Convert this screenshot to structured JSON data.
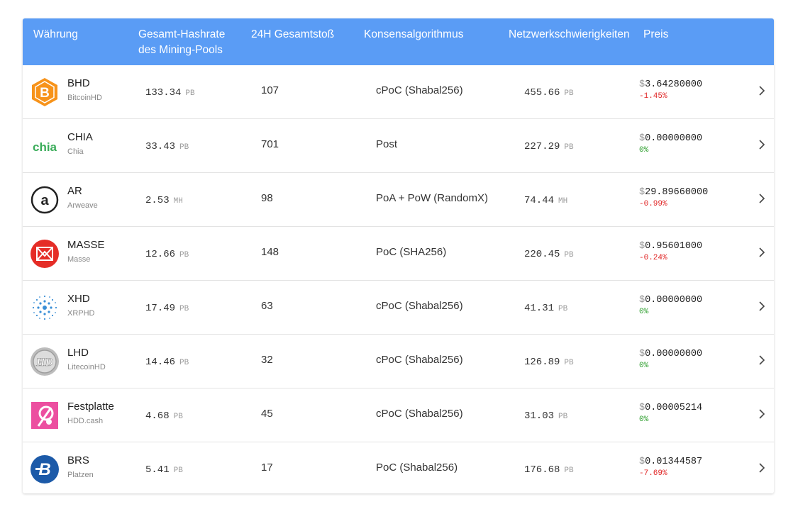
{
  "header": {
    "currency": "Währung",
    "hashrate_line1": "Gesamt-Hashrate",
    "hashrate_line2": "des Mining-Pools",
    "blocks": "24H Gesamtstoß",
    "algorithm": "Konsensalgorithmus",
    "difficulty": "Netzwerkschwierigkeiten",
    "price": "Preis"
  },
  "colors": {
    "header_bg": "#5a9cf5",
    "negative": "#e02424",
    "neutral": "#2a9d2a"
  },
  "rows": [
    {
      "symbol": "BHD",
      "name": "BitcoinHD",
      "icon": "bitcoinhd-logo",
      "hashrate": "133.34",
      "hashrate_unit": "PB",
      "blocks": "107",
      "algorithm": "cPoC (Shabal256)",
      "difficulty": "455.66",
      "difficulty_unit": "PB",
      "currency_symbol": "$",
      "price": "3.64280000",
      "change": "-1.45%"
    },
    {
      "symbol": "CHIA",
      "name": "Chia",
      "icon": "chia-logo",
      "hashrate": "33.43",
      "hashrate_unit": "PB",
      "blocks": "701",
      "algorithm": "Post",
      "difficulty": "227.29",
      "difficulty_unit": "PB",
      "currency_symbol": "$",
      "price": "0.00000000",
      "change": "0%"
    },
    {
      "symbol": "AR",
      "name": "Arweave",
      "icon": "arweave-logo",
      "hashrate": "2.53",
      "hashrate_unit": "MH",
      "blocks": "98",
      "algorithm": "PoA + PoW (RandomX)",
      "difficulty": "74.44",
      "difficulty_unit": "MH",
      "currency_symbol": "$",
      "price": "29.89660000",
      "change": "-0.99%"
    },
    {
      "symbol": "MASSE",
      "name": "Masse",
      "icon": "mass-logo",
      "hashrate": "12.66",
      "hashrate_unit": "PB",
      "blocks": "148",
      "algorithm": "PoC (SHA256)",
      "difficulty": "220.45",
      "difficulty_unit": "PB",
      "currency_symbol": "$",
      "price": "0.95601000",
      "change": "-0.24%"
    },
    {
      "symbol": "XHD",
      "name": "XRPHD",
      "icon": "xrphd-logo",
      "hashrate": "17.49",
      "hashrate_unit": "PB",
      "blocks": "63",
      "algorithm": "cPoC (Shabal256)",
      "difficulty": "41.31",
      "difficulty_unit": "PB",
      "currency_symbol": "$",
      "price": "0.00000000",
      "change": "0%"
    },
    {
      "symbol": "LHD",
      "name": "LitecoinHD",
      "icon": "litecoinhd-logo",
      "hashrate": "14.46",
      "hashrate_unit": "PB",
      "blocks": "32",
      "algorithm": "cPoC (Shabal256)",
      "difficulty": "126.89",
      "difficulty_unit": "PB",
      "currency_symbol": "$",
      "price": "0.00000000",
      "change": "0%"
    },
    {
      "symbol": "Festplatte",
      "name": "HDD.cash",
      "icon": "hddcash-logo",
      "hashrate": "4.68",
      "hashrate_unit": "PB",
      "blocks": "45",
      "algorithm": "cPoC (Shabal256)",
      "difficulty": "31.03",
      "difficulty_unit": "PB",
      "currency_symbol": "$",
      "price": "0.00005214",
      "change": "0%"
    },
    {
      "symbol": "BRS",
      "name": "Platzen",
      "icon": "burst-logo",
      "hashrate": "5.41",
      "hashrate_unit": "PB",
      "blocks": "17",
      "algorithm": "PoC (Shabal256)",
      "difficulty": "176.68",
      "difficulty_unit": "PB",
      "currency_symbol": "$",
      "price": "0.01344587",
      "change": "-7.69%"
    }
  ]
}
